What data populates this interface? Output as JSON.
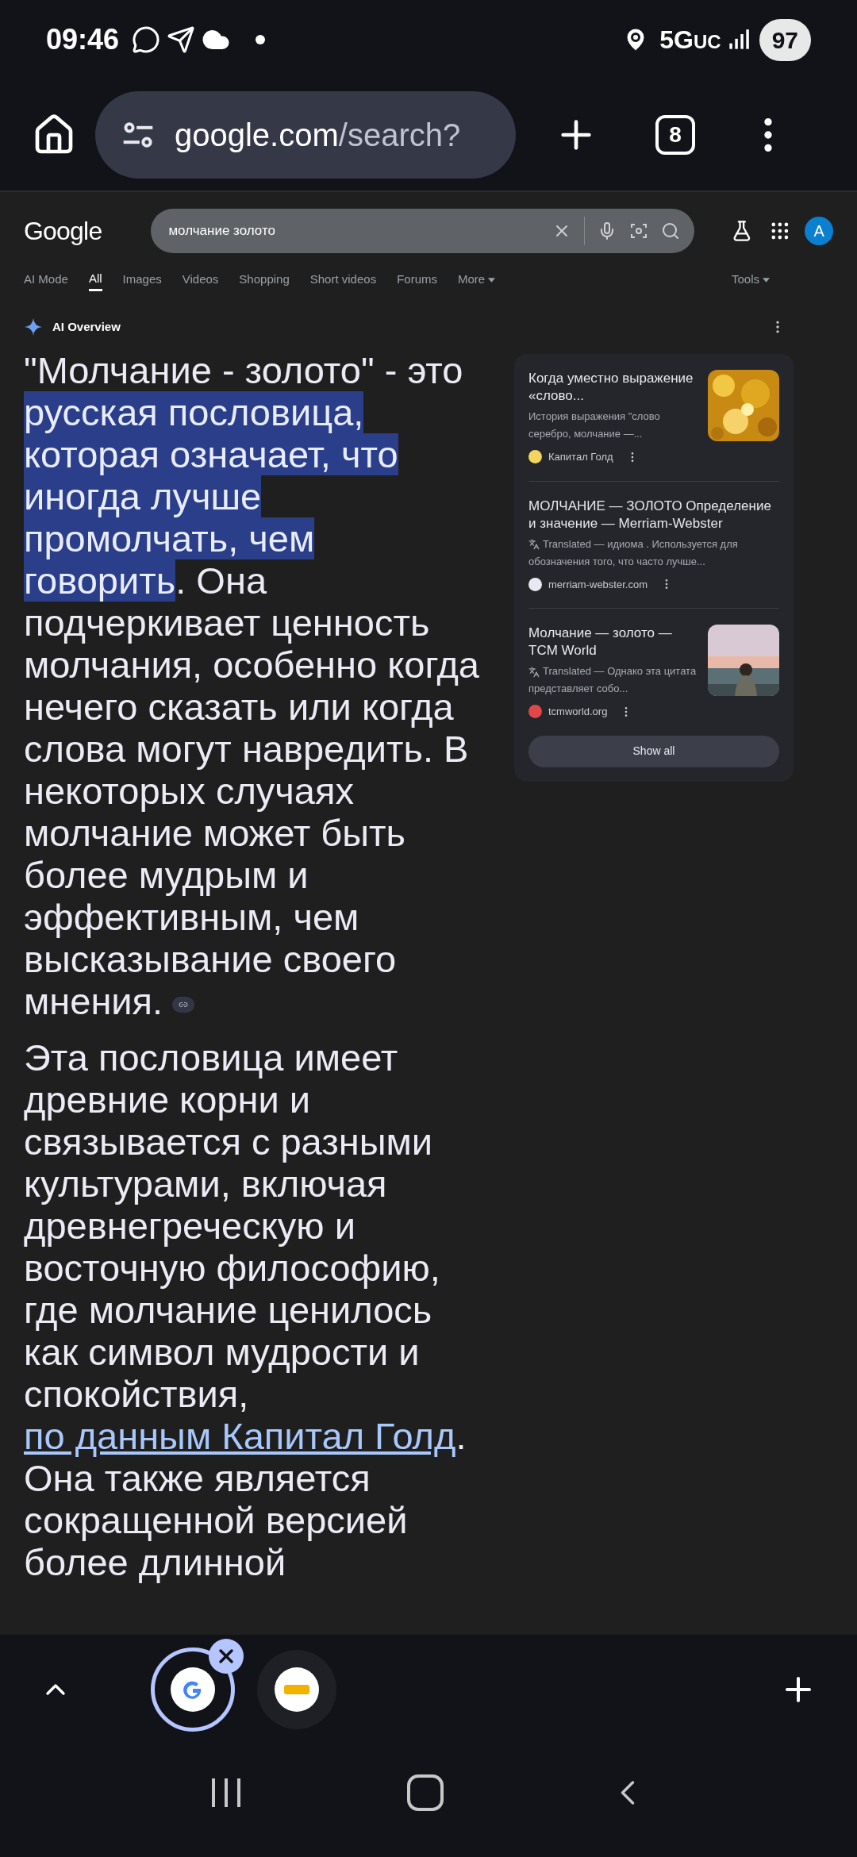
{
  "status_bar": {
    "time": "09:46",
    "network": "5G",
    "network_sub": "UC",
    "battery": "97"
  },
  "toolbar": {
    "url_host": "google.com",
    "url_path": "/search?",
    "tab_count": "8"
  },
  "google": {
    "logo": "Google",
    "query": "молчание золото",
    "avatar": "A",
    "tabs": [
      {
        "label": "AI Mode",
        "selected": false,
        "dropdown": false
      },
      {
        "label": "All",
        "selected": true,
        "dropdown": false
      },
      {
        "label": "Images",
        "selected": false,
        "dropdown": false
      },
      {
        "label": "Videos",
        "selected": false,
        "dropdown": false
      },
      {
        "label": "Shopping",
        "selected": false,
        "dropdown": false
      },
      {
        "label": "Short videos",
        "selected": false,
        "dropdown": false
      },
      {
        "label": "Forums",
        "selected": false,
        "dropdown": false
      },
      {
        "label": "More",
        "selected": false,
        "dropdown": true
      }
    ],
    "tools": "Tools"
  },
  "ai_overview": {
    "title": "AI Overview",
    "paragraphs": [
      {
        "segments": [
          {
            "kind": "plain",
            "text": "\"Молчание - золото\" - это "
          },
          {
            "kind": "highlight",
            "text": "русская пословица, которая означает, что иногда лучше промолчать, чем говорить"
          },
          {
            "kind": "plain",
            "text": ". Она подчеркивает ценность молчания, особенно когда нечего сказать или когда слова могут навредить. В некоторых случаях молчание может быть более мудрым и эффективным, чем высказывание своего мнения."
          }
        ],
        "link_chip": true
      },
      {
        "segments": [
          {
            "kind": "plain",
            "text": "Эта пословица имеет древние корни и связывается с разными культурами, включая древнегреческую и восточную философию, где молчание ценилось как символ мудрости и спокойствия, "
          },
          {
            "kind": "link",
            "text": "по данным Капитал Голд"
          },
          {
            "kind": "plain",
            "text": ". Она также является сокращенной версией более длинной"
          }
        ],
        "link_chip": false
      }
    ],
    "sources": [
      {
        "title": "Когда уместно выражение «слово...",
        "snippet": "История выражения \"слово серебро, молчание —...",
        "translated": false,
        "site": "Капитал Голд",
        "color": "#f4d35e"
      },
      {
        "title": "МОЛЧАНИЕ — ЗОЛОТО Определение и значение — Merriam-Webster",
        "translated_label": "Translated",
        "snippet": " — идиома . Используется для обозначения того, что часто лучше...",
        "translated": true,
        "site": "merriam-webster.com",
        "color": "#e8e8f0"
      },
      {
        "title": "Молчание — золото — TCM World",
        "translated_label": "Translated",
        "snippet": " — Однако эта цитата представляет собо...",
        "translated": true,
        "site": "tcmworld.org",
        "color": "#e04848"
      }
    ],
    "show_all": "Show all"
  }
}
